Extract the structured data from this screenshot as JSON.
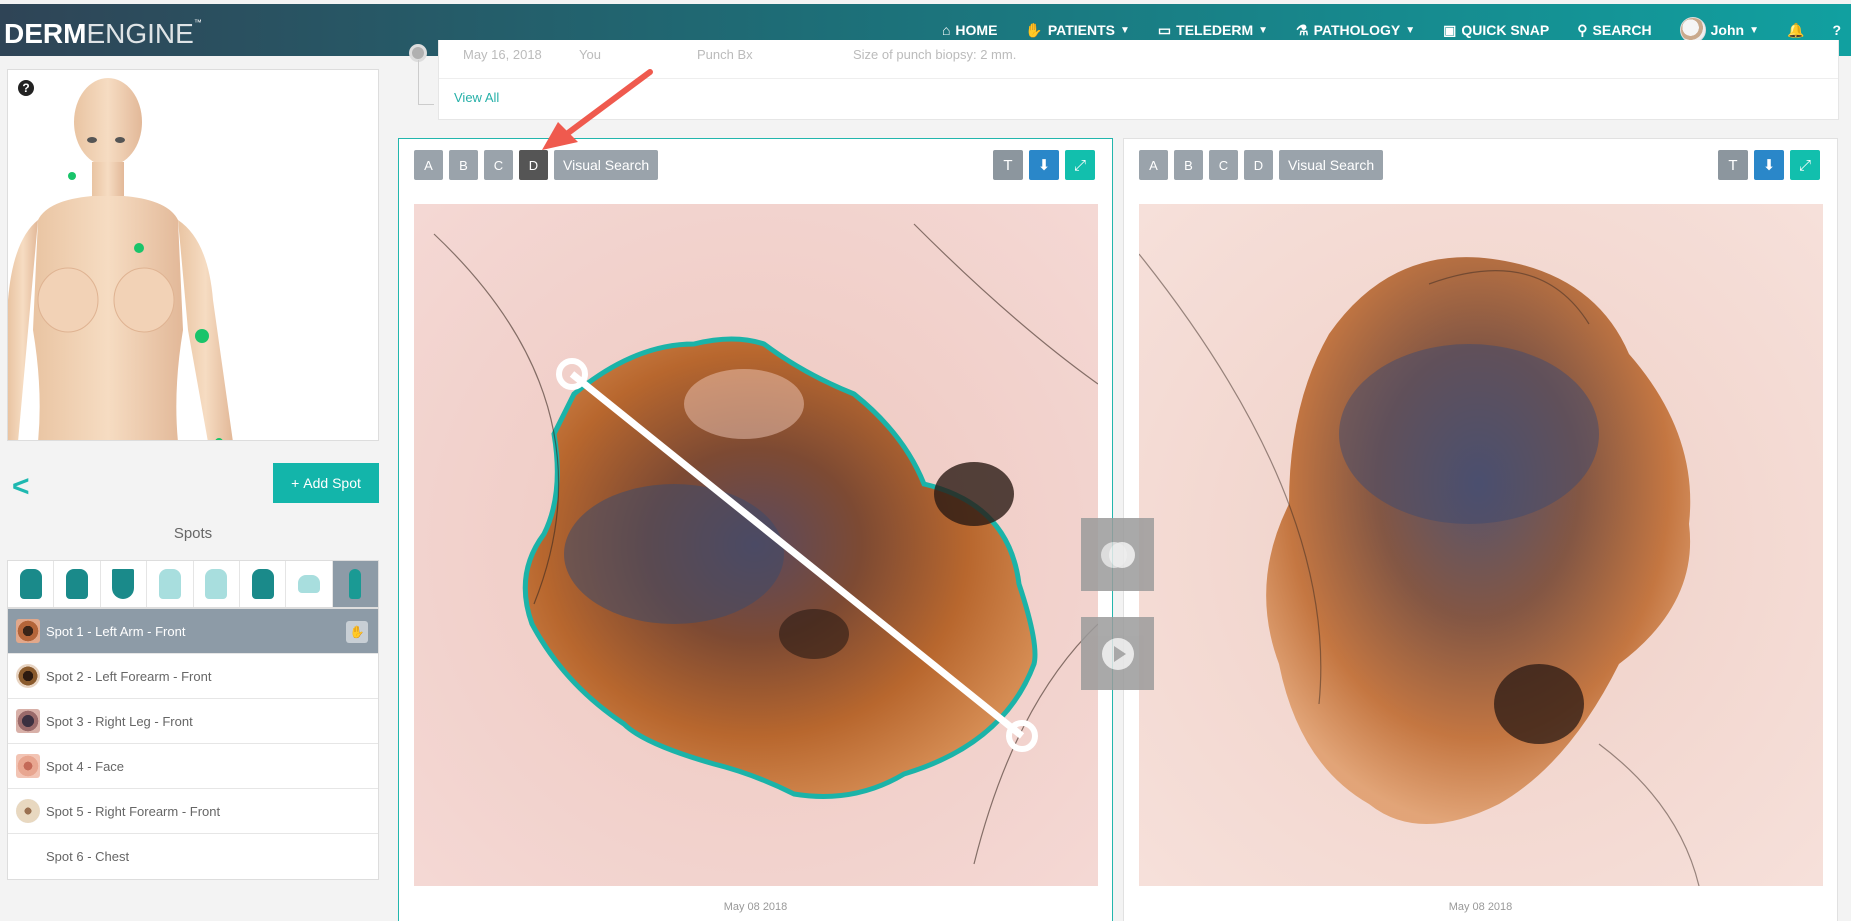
{
  "app": {
    "logo_bold": "DERM",
    "logo_light": "ENGINE",
    "logo_tm": "™"
  },
  "nav": {
    "home": "HOME",
    "patients": "PATIENTS",
    "telederm": "TELEDERM",
    "pathology": "PATHOLOGY",
    "quick_snap": "QUICK SNAP",
    "search": "SEARCH",
    "user": "John"
  },
  "timeline": {
    "date_cut": "May 16, 2018",
    "who_cut": "You",
    "type_cut": "Punch Bx",
    "note_cut": "Size of punch biopsy: 2 mm.",
    "view_all": "View All"
  },
  "left_panel": {
    "add_spot": "Add Spot",
    "spots_title": "Spots",
    "spots": [
      {
        "label": "Spot 1 - Left Arm - Front",
        "active": true
      },
      {
        "label": "Spot 2 - Left Forearm - Front"
      },
      {
        "label": "Spot 3 - Right Leg - Front"
      },
      {
        "label": "Spot 4 - Face"
      },
      {
        "label": "Spot 5 - Right Forearm - Front"
      },
      {
        "label": "Spot 6 - Chest"
      }
    ]
  },
  "panels": {
    "left": {
      "a": "A",
      "b": "B",
      "c": "C",
      "d": "D",
      "visual_search": "Visual Search",
      "date": "May 08 2018"
    },
    "right": {
      "a": "A",
      "b": "B",
      "c": "C",
      "d": "D",
      "visual_search": "Visual Search",
      "date": "May 08 2018"
    }
  },
  "colors": {
    "accent": "#13b5aa",
    "border_outline": "#1bb3a8",
    "active_row": "#8d9ba7"
  },
  "icons": [
    "home-icon",
    "patients-icon",
    "telederm-icon",
    "pathology-icon",
    "quick-snap-icon",
    "search-icon",
    "bell-icon",
    "help-icon",
    "ruler-icon",
    "download-icon",
    "expand-icon",
    "compare-icon",
    "play-icon"
  ]
}
